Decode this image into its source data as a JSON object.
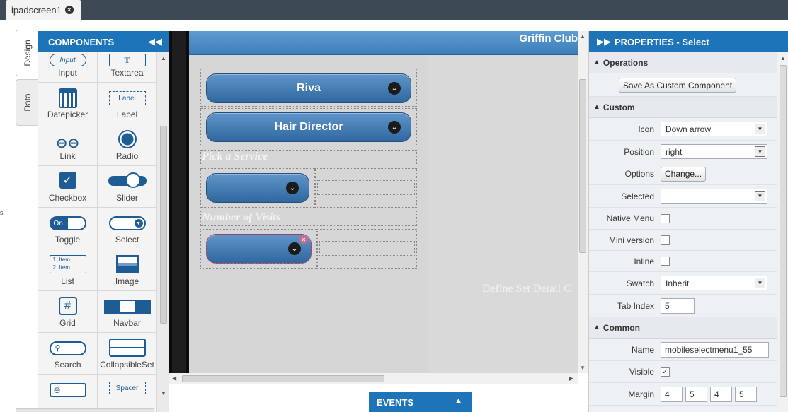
{
  "top_tab": {
    "label": "ipadscreen1",
    "close_icon": "close-circle-icon"
  },
  "side_tabs": {
    "design": "Design",
    "data": "Data"
  },
  "components": {
    "title": "COMPONENTS",
    "items": [
      {
        "label": "Input",
        "icon": "input-icon",
        "badge": "Input"
      },
      {
        "label": "Textarea",
        "icon": "textarea-icon",
        "badge": "T"
      },
      {
        "label": "Datepicker",
        "icon": "calendar-icon"
      },
      {
        "label": "Label",
        "icon": "label-icon",
        "badge": "Label"
      },
      {
        "label": "Link",
        "icon": "link-icon"
      },
      {
        "label": "Radio",
        "icon": "radio-icon"
      },
      {
        "label": "Checkbox",
        "icon": "checkbox-icon"
      },
      {
        "label": "Slider",
        "icon": "slider-icon"
      },
      {
        "label": "Toggle",
        "icon": "toggle-icon",
        "badge": "On"
      },
      {
        "label": "Select",
        "icon": "select-icon"
      },
      {
        "label": "List",
        "icon": "list-icon",
        "badge1": "1. Item",
        "badge2": "2. Item"
      },
      {
        "label": "Image",
        "icon": "image-icon"
      },
      {
        "label": "Grid",
        "icon": "grid-icon"
      },
      {
        "label": "Navbar",
        "icon": "navbar-icon"
      },
      {
        "label": "Search",
        "icon": "search-icon"
      },
      {
        "label": "CollapsibleSet",
        "icon": "collapsible-set-icon"
      },
      {
        "label": "",
        "icon": "add-button-icon"
      },
      {
        "label": "",
        "icon": "spacer-icon",
        "badge": "Spacer"
      }
    ]
  },
  "screen": {
    "header_title": "Griffin Club",
    "select_1": "Riva",
    "select_2": "Hair Director",
    "label_service": "Pick a Service",
    "label_visits": "Number of Visits",
    "right_placeholder": "Define Set Detail C"
  },
  "events": {
    "label": "EVENTS"
  },
  "properties": {
    "title": "PROPERTIES - Select",
    "operations": {
      "heading": "Operations",
      "save_custom": "Save As Custom Component"
    },
    "custom": {
      "heading": "Custom",
      "icon_label": "Icon",
      "icon_value": "Down arrow",
      "position_label": "Position",
      "position_value": "right",
      "options_label": "Options",
      "options_button": "Change...",
      "selected_label": "Selected",
      "selected_value": "",
      "native_menu_label": "Native Menu",
      "mini_label": "Mini version",
      "inline_label": "Inline",
      "swatch_label": "Swatch",
      "swatch_value": "Inherit",
      "tabindex_label": "Tab Index",
      "tabindex_value": "5"
    },
    "common": {
      "heading": "Common",
      "name_label": "Name",
      "name_value": "mobileselectmenu1_55",
      "visible_label": "Visible",
      "margin_label": "Margin",
      "margin_values": [
        "4",
        "5",
        "4",
        "5"
      ]
    }
  }
}
